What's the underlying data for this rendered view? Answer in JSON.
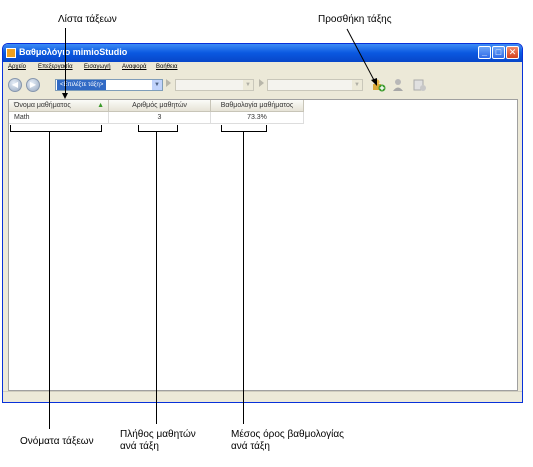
{
  "annotations": {
    "class_list": "Λίστα τάξεων",
    "add_class": "Προσθήκη τάξης",
    "class_names": "Ονόματα τάξεων",
    "students_count_line1": "Πλήθος μαθητών",
    "students_count_line2": "ανά τάξη",
    "grade_average_line1": "Μέσος όρος βαθμολογίας",
    "grade_average_line2": "ανά τάξη"
  },
  "window": {
    "title": "Βαθμολόγιο mimioStudio",
    "controls": {
      "minimize": "_",
      "maximize": "□",
      "close": "✕"
    }
  },
  "menu": [
    "Αρχείο",
    "Επεξεργασία",
    "Εισαγωγή",
    "Αναφορά",
    "Βοήθεια"
  ],
  "toolbar": {
    "back_icon": "arrow-left-icon",
    "forward_icon": "arrow-right-icon",
    "class_select_value": "<Επιλέξτε τάξη>",
    "add_class_icon": "add-class-icon",
    "user_icon": "user-icon",
    "export_icon": "export-icon"
  },
  "grid": {
    "columns": [
      "Όνομα μαθήματος",
      "Αριθμός μαθητών",
      "Βαθμολογία μαθήματος"
    ],
    "rows": [
      {
        "name": "Math",
        "students": "3",
        "score": "73.3%"
      }
    ]
  },
  "colors": {
    "titlebar": "#0a58e0",
    "selection": "#316ac5",
    "sort_arrow": "#3a9a2a"
  }
}
